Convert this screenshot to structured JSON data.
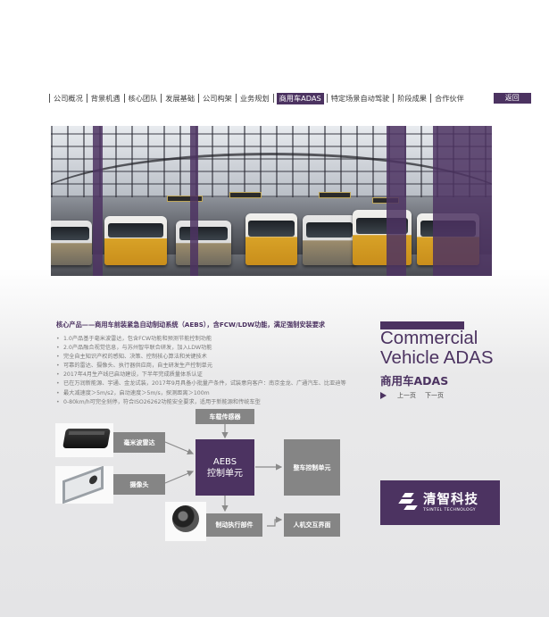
{
  "nav": {
    "items": [
      "公司概况",
      "背景机遇",
      "核心团队",
      "发展基础",
      "公司构架",
      "业务规划",
      "商用车ADAS",
      "特定场景自动驾驶",
      "阶段成果",
      "合作伙伴"
    ],
    "active_index": 6,
    "back_label": "返回"
  },
  "product": {
    "heading": "核心产品——商用车前装紧急自动制动系统（AEBS），含FCW/LDW功能，满足强制安装要求",
    "bullets": [
      "1.0产品基于毫米波雷达，包含FCW功能和预测节能控制功能",
      "2.0产品融合视觉信息，与苏州智华联合研发，加入LDW功能",
      "完全自主知识产权的感知、决策、控制核心算法和关键技术",
      "可靠的雷达、摄像头、执行器供应商，自主研发生产控制单元",
      "2017年4月生产线已启动建设，下半年完成质量体系认证",
      "已在万润新能源、宇通、金龙试装，2017年9月具备小批量产条件，试装意向客户：南京金龙、广通汽车、比亚迪等",
      "最大减速度＞5m/s2，启动速度＞5m/s，探测距离＞100m",
      "0-80km/h可完全刹停，符合ISO26262功能安全要求，适用于新能源和传统车型"
    ]
  },
  "title": {
    "en_line1": "Commercial",
    "en_line2": "Vehicle ADAS",
    "cn": "商用车ADAS"
  },
  "pager": {
    "prev": "上一页",
    "next": "下一页"
  },
  "logo": {
    "cn": "清智科技",
    "en": "TSINTEL TECHNOLOGY"
  },
  "diagram": {
    "vehicle_sensor": "车载传感器",
    "radar": "毫米波雷达",
    "camera": "摄像头",
    "aebs_line1": "AEBS",
    "aebs_line2": "控制单元",
    "vehicle_control": "整车控制单元",
    "actuator": "制动执行部件",
    "hmi": "人机交互界面"
  },
  "colors": {
    "brand_purple": "#4c3361",
    "box_gray": "#858585"
  }
}
